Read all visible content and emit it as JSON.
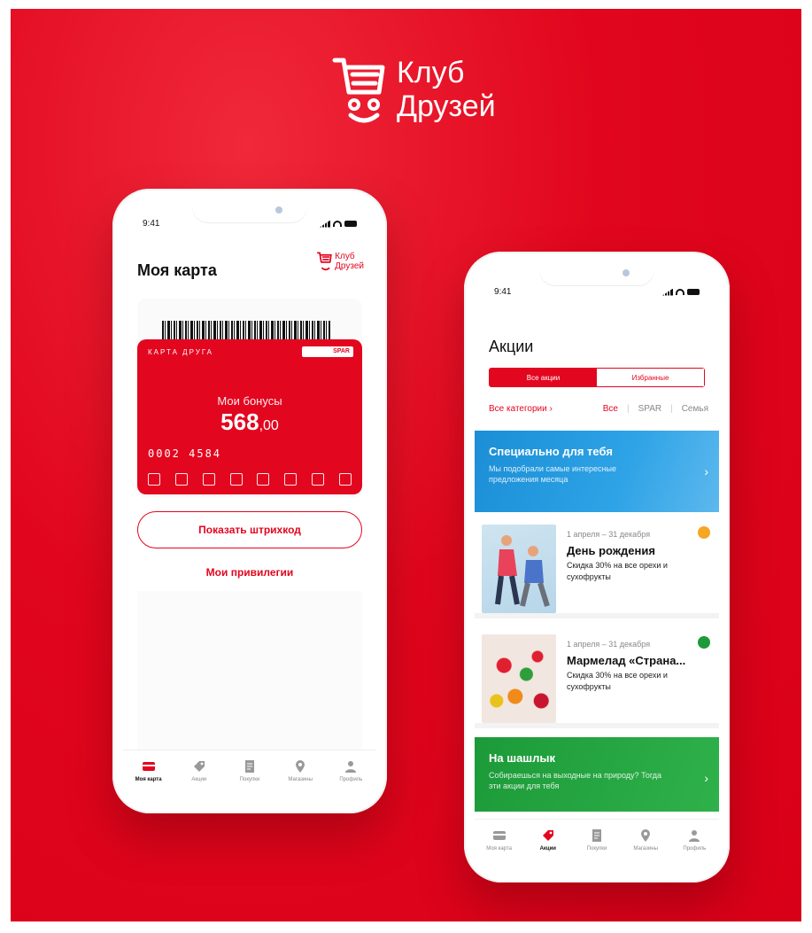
{
  "brand": {
    "line1": "Клуб",
    "line2": "Друзей"
  },
  "status": {
    "time": "9:41"
  },
  "card_screen": {
    "title": "Моя карта",
    "mini_logo_line1": "Клуб",
    "mini_logo_line2": "Друзей",
    "card_label": "КАРТА ДРУГА",
    "spar_label": "SPAR",
    "bonus_label": "Мои бонусы",
    "bonus_int": "568",
    "bonus_dec": ",00",
    "card_number": "0002 4584",
    "show_barcode_label": "Показать штрихкод",
    "privileges_label": "Мои привилегии"
  },
  "promo_screen": {
    "title": "Акции",
    "seg_all": "Все акции",
    "seg_fav": "Избранные",
    "filter_categories": "Все категории ›",
    "filter_all": "Все",
    "filter_spar": "SPAR",
    "filter_family": "Семья",
    "banner_personal_title": "Специально для тебя",
    "banner_personal_sub": "Мы подобрали самые интересные предложения месяца",
    "offers": [
      {
        "date": "1 апреля – 31 декабря",
        "name": "День рождения",
        "desc": "Скидка 30% на все орехи и сухофрукты"
      },
      {
        "date": "1 апреля – 31 декабря",
        "name": "Мармелад «Страна...",
        "desc": "Скидка 30% на все орехи и сухофрукты"
      }
    ],
    "banner_bbq_title": "На шашлык",
    "banner_bbq_sub": "Собираешься на выходные на природу? Тогда эти акции для тебя"
  },
  "tabs": [
    {
      "label": "Моя карта",
      "icon": "card-icon"
    },
    {
      "label": "Акции",
      "icon": "tag-icon"
    },
    {
      "label": "Покупки",
      "icon": "receipt-icon"
    },
    {
      "label": "Магазины",
      "icon": "pin-icon"
    },
    {
      "label": "Профиль",
      "icon": "person-icon"
    }
  ],
  "colors": {
    "brand_red": "#e3061f",
    "promo_blue": "#2ea3e6",
    "promo_green": "#2fb14a"
  }
}
